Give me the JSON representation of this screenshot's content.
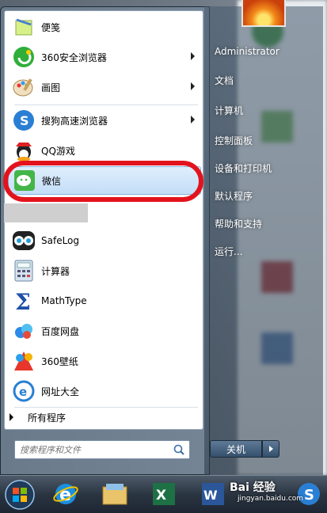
{
  "start_menu": {
    "pinned": [
      {
        "label": "便笺",
        "icon": "sticky-notes-icon",
        "has_submenu": false
      },
      {
        "label": "360安全浏览器",
        "icon": "360-browser-icon",
        "has_submenu": true
      },
      {
        "label": "画图",
        "icon": "paint-icon",
        "has_submenu": true
      }
    ],
    "recent": [
      {
        "label": "搜狗高速浏览器",
        "icon": "sogou-browser-icon",
        "has_submenu": true
      },
      {
        "label": "QQ游戏",
        "icon": "qq-game-icon",
        "has_submenu": false
      },
      {
        "label": "微信",
        "icon": "wechat-icon",
        "has_submenu": false,
        "highlighted": true
      },
      {
        "label": "SafeLog",
        "icon": "safelog-icon",
        "has_submenu": false
      },
      {
        "label": "计算器",
        "icon": "calculator-icon",
        "has_submenu": false
      },
      {
        "label": "MathType",
        "icon": "mathtype-icon",
        "has_submenu": false
      },
      {
        "label": "百度网盘",
        "icon": "baidu-netdisk-icon",
        "has_submenu": false
      },
      {
        "label": "360壁纸",
        "icon": "360-wallpaper-icon",
        "has_submenu": false
      },
      {
        "label": "网址大全",
        "icon": "url-directory-icon",
        "has_submenu": false
      }
    ],
    "all_programs": "所有程序",
    "search_placeholder": "搜索程序和文件",
    "right": {
      "user": "Administrator",
      "items": [
        "文档",
        "计算机",
        "控制面板",
        "设备和打印机",
        "默认程序",
        "帮助和支持",
        "运行..."
      ],
      "shutdown": "关机"
    }
  },
  "taskbar": {
    "apps": [
      "start-orb-icon",
      "internet-explorer-icon",
      "file-explorer-icon",
      "excel-icon",
      "word-icon",
      "sogou-icon"
    ]
  },
  "watermark": {
    "text": "Bai 经验",
    "url": "jingyan.baidu.com"
  },
  "colors": {
    "highlight_ring": "#e3131d",
    "highlight_bg": "#c3def8"
  }
}
